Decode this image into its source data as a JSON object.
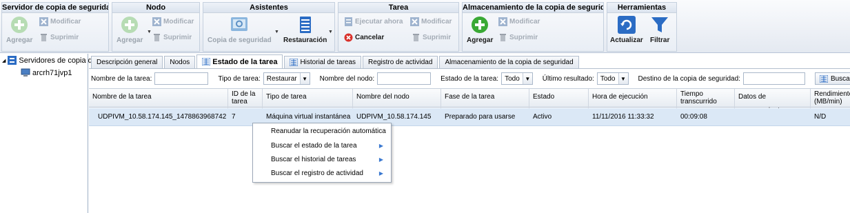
{
  "ribbon": {
    "groups": {
      "servidor": {
        "title": "Servidor de copia de seguridad",
        "add": "Agregar",
        "modify": "Modificar",
        "delete": "Suprimir"
      },
      "nodo": {
        "title": "Nodo",
        "add": "Agregar",
        "modify": "Modificar",
        "delete": "Suprimir"
      },
      "asistentes": {
        "title": "Asistentes",
        "backup": "Copia de seguridad",
        "restore": "Restauración"
      },
      "tarea": {
        "title": "Tarea",
        "run_now": "Ejecutar ahora",
        "modify": "Modificar",
        "cancel": "Cancelar",
        "delete": "Suprimir"
      },
      "almacenamiento": {
        "title": "Almacenamiento de la copia de seguridad",
        "add": "Agregar",
        "modify": "Modificar",
        "delete": "Suprimir"
      },
      "herramientas": {
        "title": "Herramientas",
        "refresh": "Actualizar",
        "filter": "Filtrar"
      }
    }
  },
  "tree": {
    "root": "Servidores de copia de",
    "child": "arcrh71jvp1"
  },
  "tabs": [
    {
      "label": "Descripción general"
    },
    {
      "label": "Nodos"
    },
    {
      "label": "Estado de la tarea"
    },
    {
      "label": "Historial de tareas"
    },
    {
      "label": "Registro de actividad"
    },
    {
      "label": "Almacenamiento de la copia de seguridad"
    }
  ],
  "filter": {
    "task_name_label": "Nombre de la tarea:",
    "task_name_value": "",
    "task_type_label": "Tipo de tarea:",
    "task_type_value": "Restaurar",
    "node_name_label": "Nombre del nodo:",
    "node_name_value": "",
    "task_state_label": "Estado de la tarea:",
    "task_state_value": "Todo",
    "last_result_label": "Último resultado:",
    "last_result_value": "Todo",
    "destination_label": "Destino de la copia de seguridad:",
    "destination_value": "",
    "search_button": "Buscar"
  },
  "table": {
    "headers": [
      "Nombre de la tarea",
      "ID de la tarea",
      "Tipo de tarea",
      "Nombre del nodo",
      "Fase de la tarea",
      "Estado",
      "Hora de ejecución",
      "Tiempo transcurrido",
      "Datos de procesamiento",
      "Rendimiento (MB/min)"
    ],
    "rows": [
      [
        "UDPIVM_10.58.174.145_1478863968742",
        "7",
        "Máquina virtual instantánea",
        "UDPIVM_10.58.174.145",
        "Preparado para usarse",
        "Activo",
        "11/11/2016 11:33:32",
        "00:09:08",
        "",
        "N/D"
      ]
    ]
  },
  "context_menu": {
    "items": [
      {
        "label": "Reanudar la recuperación automática",
        "submenu": false
      },
      {
        "label": "Buscar el estado de la tarea",
        "submenu": true
      },
      {
        "label": "Buscar el historial de tareas",
        "submenu": true
      },
      {
        "label": "Buscar el registro de actividad",
        "submenu": true
      }
    ]
  },
  "colors": {
    "selected_row": "#dbe8f6",
    "accent": "#2b6cc4",
    "add_green": "#3aa935",
    "cancel_red": "#d9312b"
  }
}
